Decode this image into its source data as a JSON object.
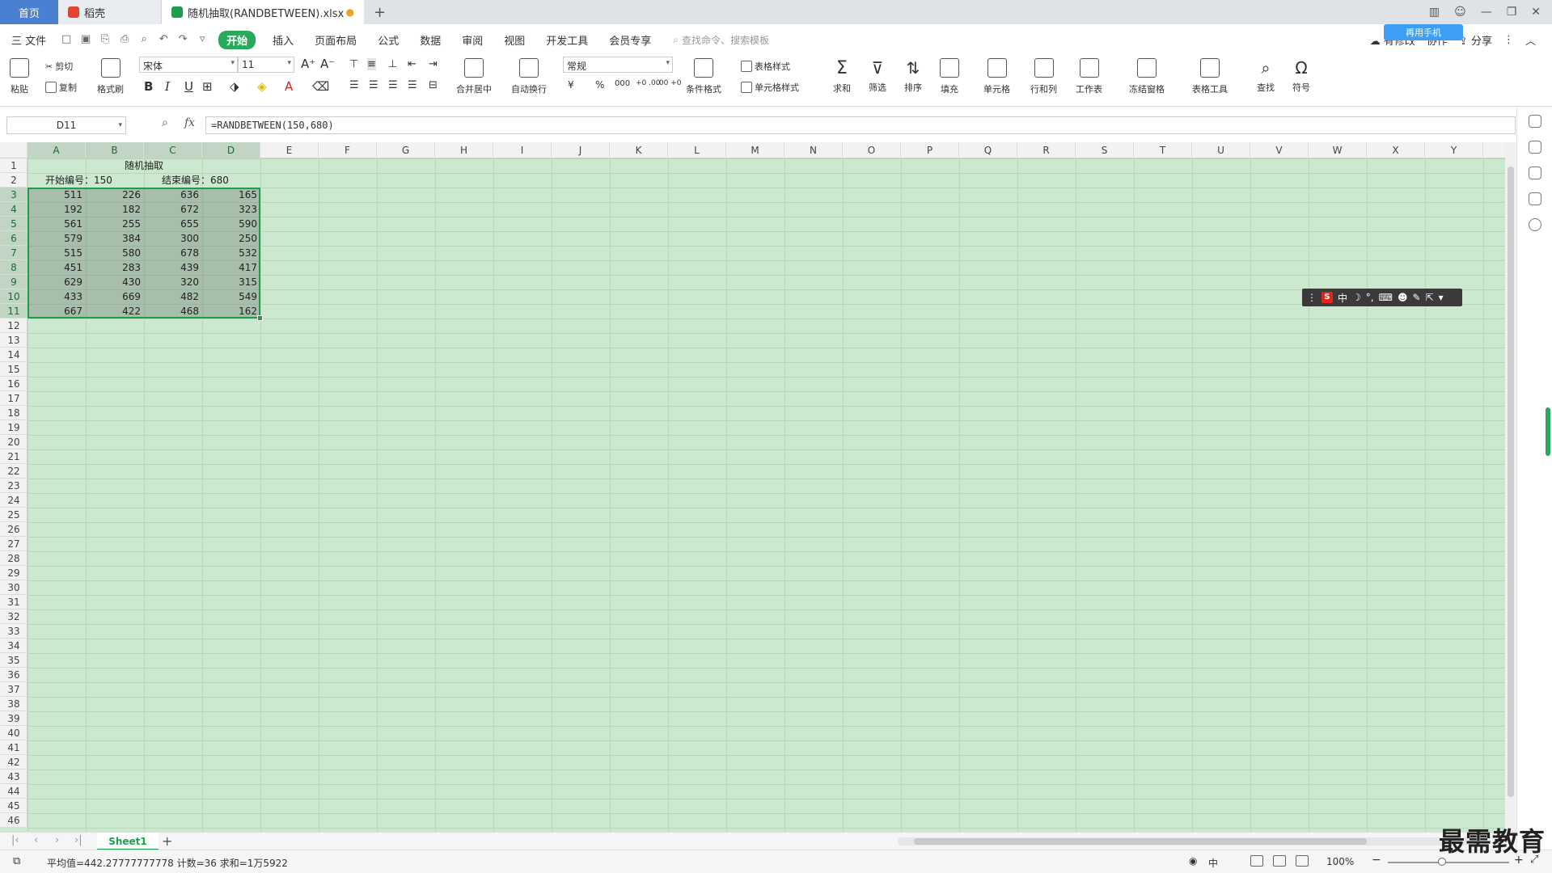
{
  "tabs": {
    "home": "首页",
    "daoke": "稻壳",
    "file": "随机抽取(RANDBETWEEN).xlsx",
    "modified_dot": "●",
    "close": "×",
    "add": "+"
  },
  "menu": {
    "file": "三 文件",
    "items": [
      "开始",
      "插入",
      "页面布局",
      "公式",
      "数据",
      "审阅",
      "视图",
      "开发工具",
      "会员专享"
    ],
    "search_placeholder": "查找命令、搜索模板",
    "unsynced": "有修改",
    "collab": "协作",
    "share": "分享",
    "badge": "再用手机"
  },
  "ribbon": {
    "paste": "粘贴",
    "cut": "剪切",
    "copy": "复制",
    "format_painter": "格式刷",
    "font_name": "宋体",
    "font_size": "11",
    "merge": "合并居中",
    "wrap": "自动换行",
    "number_format": "常规",
    "cond_format": "条件格式",
    "table_style": "表格样式",
    "cell_style": "单元格样式",
    "sum": "求和",
    "filter": "筛选",
    "sort": "排序",
    "fill": "填充",
    "cell": "单元格",
    "rowcol": "行和列",
    "worksheet": "工作表",
    "freeze": "冻结窗格",
    "table_tools": "表格工具",
    "find": "查找",
    "symbol": "符号",
    "currency": "¥",
    "percent": "%",
    "thousands": "000",
    "inc_dec": "+0 .00",
    "dec_dec": ".00 +0"
  },
  "formula_bar": {
    "cell_ref": "D11",
    "fx": "fx",
    "formula": "=RANDBETWEEN(150,680)"
  },
  "grid": {
    "columns": [
      "A",
      "B",
      "C",
      "D",
      "E",
      "F",
      "G",
      "H",
      "I",
      "J",
      "K",
      "L",
      "M",
      "N",
      "O",
      "P",
      "Q",
      "R",
      "S",
      "T",
      "U",
      "V",
      "W",
      "X",
      "Y"
    ],
    "rows": [
      "1",
      "2",
      "3",
      "4",
      "5",
      "6",
      "7",
      "8",
      "9",
      "10",
      "11",
      "12",
      "13",
      "14",
      "15",
      "16",
      "17",
      "18",
      "19",
      "20",
      "21",
      "22",
      "23",
      "24",
      "25",
      "26",
      "27",
      "28",
      "29",
      "30",
      "31",
      "32",
      "33",
      "34",
      "35",
      "36",
      "37",
      "38",
      "39",
      "40",
      "41",
      "42",
      "43",
      "44",
      "45",
      "46"
    ],
    "title": "随机抽取",
    "start_label": "开始编号：150",
    "end_label": "结束编号：680",
    "data": [
      [
        "511",
        "226",
        "636",
        "165"
      ],
      [
        "192",
        "182",
        "672",
        "323"
      ],
      [
        "561",
        "255",
        "655",
        "590"
      ],
      [
        "579",
        "384",
        "300",
        "250"
      ],
      [
        "515",
        "580",
        "678",
        "532"
      ],
      [
        "451",
        "283",
        "439",
        "417"
      ],
      [
        "629",
        "430",
        "320",
        "315"
      ],
      [
        "433",
        "669",
        "482",
        "549"
      ],
      [
        "667",
        "422",
        "468",
        "162"
      ]
    ]
  },
  "ime": {
    "lang": "中"
  },
  "sheets": {
    "active": "Sheet1",
    "add": "+"
  },
  "status": {
    "summary": "平均值=442.27777777778  计数=36  求和=1万5922",
    "ime_lang": "中",
    "zoom": "100%"
  },
  "watermark": "最需教育",
  "colors": {
    "accent": "#1e9e4d",
    "grid_bg": "#cce8cf"
  }
}
